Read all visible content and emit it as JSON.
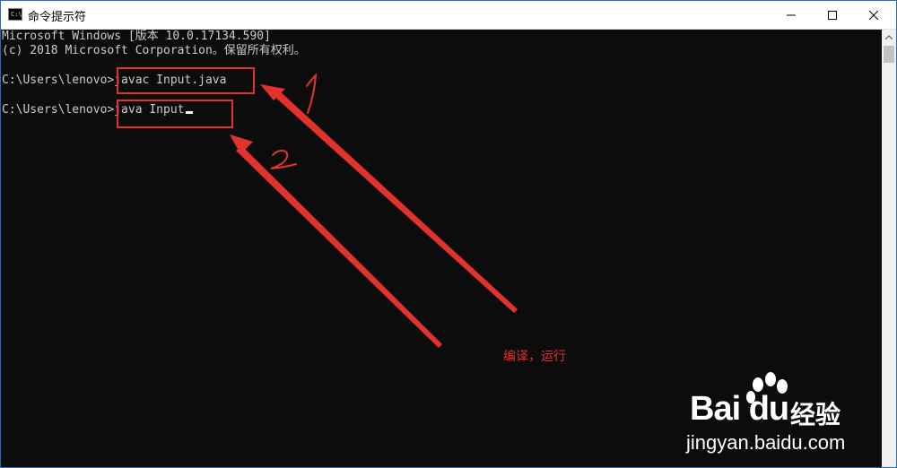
{
  "window": {
    "title": "命令提示符",
    "icon": "cmd-icon",
    "icon_glyph": "C:\\_",
    "controls": [
      "minimize-icon",
      "maximize-icon",
      "close-icon"
    ],
    "border_color": "#1e6fbf"
  },
  "console": {
    "lines": [
      "Microsoft Windows [版本 10.0.17134.590]",
      "(c) 2018 Microsoft Corporation。保留所有权利。",
      "",
      "C:\\Users\\lenovo>javac Input.java",
      "",
      "C:\\Users\\lenovo>java Input"
    ],
    "background": "#0c0c0c",
    "foreground": "#cccccc"
  },
  "annotations": {
    "color": "#e2322e",
    "step1": "1",
    "step2": "2",
    "label": "编译，运行"
  },
  "watermark": {
    "logo": "Bai du",
    "brand": "经验",
    "url": "jingyan.baidu.com"
  }
}
